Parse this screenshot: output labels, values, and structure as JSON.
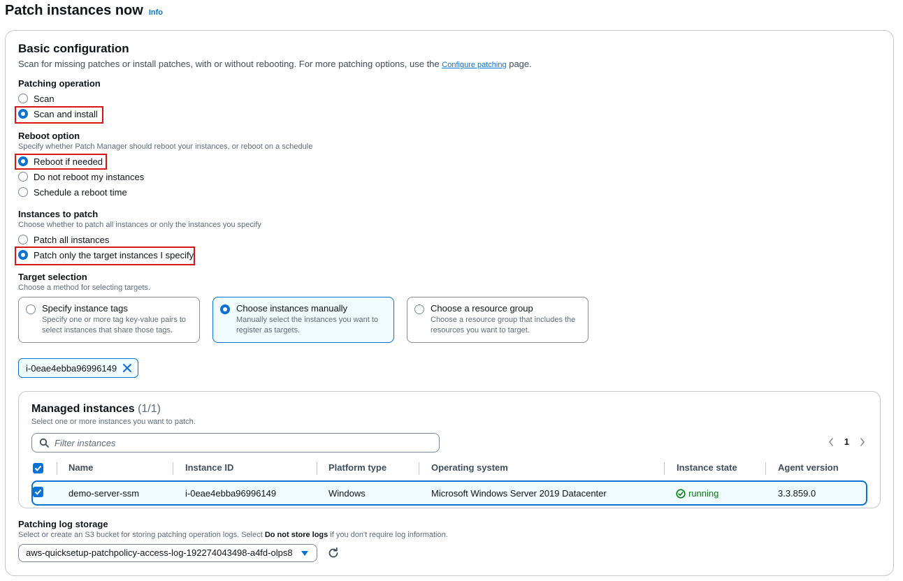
{
  "header": {
    "title": "Patch instances now",
    "info_link": "Info"
  },
  "basic": {
    "title": "Basic configuration",
    "desc_before": "Scan for missing patches or install patches, with or without rebooting. For more patching options, use the ",
    "desc_link": "Configure patching",
    "desc_after": " page."
  },
  "patching_operation": {
    "label": "Patching operation",
    "options": [
      "Scan",
      "Scan and install"
    ],
    "selected": "Scan and install"
  },
  "reboot": {
    "label": "Reboot option",
    "desc": "Specify whether Patch Manager should reboot your instances, or reboot on a schedule",
    "options": [
      "Reboot if needed",
      "Do not reboot my instances",
      "Schedule a reboot time"
    ],
    "selected": "Reboot if needed"
  },
  "instances_to_patch": {
    "label": "Instances to patch",
    "desc": "Choose whether to patch all instances or only the instances you specify",
    "options": [
      "Patch all instances",
      "Patch only the target instances I specify"
    ],
    "selected": "Patch only the target instances I specify"
  },
  "target_selection": {
    "label": "Target selection",
    "desc": "Choose a method for selecting targets.",
    "tiles": [
      {
        "title": "Specify instance tags",
        "desc": "Specify one or more tag key-value pairs to select instances that share those tags."
      },
      {
        "title": "Choose instances manually",
        "desc": "Manually select the instances you want to register as targets."
      },
      {
        "title": "Choose a resource group",
        "desc": "Choose a resource group that includes the resources you want to target."
      }
    ],
    "selected": "Choose instances manually"
  },
  "token": {
    "label": "i-0eae4ebba96996149"
  },
  "managed_instances": {
    "title": "Managed instances",
    "count": "(1/1)",
    "desc": "Select one or more instances you want to patch.",
    "filter_placeholder": "Filter instances",
    "page": "1",
    "columns": [
      "Name",
      "Instance ID",
      "Platform type",
      "Operating system",
      "Instance state",
      "Agent version"
    ],
    "rows": [
      {
        "name": "demo-server-ssm",
        "instance_id": "i-0eae4ebba96996149",
        "platform": "Windows",
        "os": "Microsoft Windows Server 2019 Datacenter",
        "state": "running",
        "agent": "3.3.859.0",
        "selected": true
      }
    ]
  },
  "log_storage": {
    "label": "Patching log storage",
    "desc_before": "Select or create an S3 bucket for storing patching operation logs. Select ",
    "desc_bold": "Do not store logs",
    "desc_after": " if you don't require log information.",
    "selected_value": "aws-quicksetup-patchpolicy-access-log-192274043498-a4fd-olps8"
  },
  "colors": {
    "accent": "#0972d3",
    "highlight": "#d91515",
    "success": "#037f0c"
  }
}
